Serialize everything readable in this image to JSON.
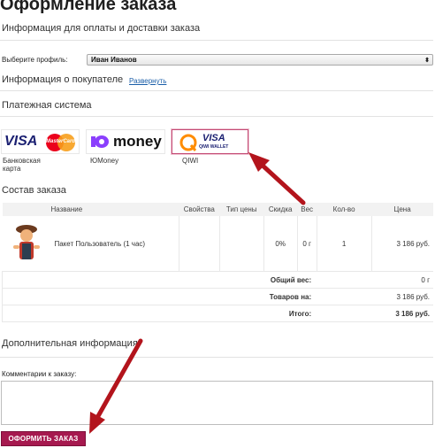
{
  "page": {
    "title": "Оформление заказа",
    "payment_delivery_info": "Информация для оплаты и доставки заказа"
  },
  "profile": {
    "label": "Выберите профиль:",
    "selected": "Иван Иванов"
  },
  "buyer": {
    "title": "Информация о покупателе",
    "expand_link": "Развернуть"
  },
  "payment": {
    "title": "Платежная система",
    "options": [
      {
        "label": "Банковская карта",
        "logo_text_1": "VISA",
        "logo_text_2": "MasterCard",
        "selected": false
      },
      {
        "label": "ЮMoney",
        "logo_text_1": "money",
        "selected": false
      },
      {
        "label": "QIWI",
        "logo_text_1": "VISA",
        "logo_text_2": "QIWI WALLET",
        "selected": true
      }
    ]
  },
  "order": {
    "title": "Состав заказа",
    "columns": [
      "Название",
      "Свойства",
      "Тип цены",
      "Скидка",
      "Вес",
      "Кол-во",
      "Цена"
    ],
    "items": [
      {
        "name": "Пакет Пользователь (1 час)",
        "properties": "",
        "price_type": "",
        "discount": "0%",
        "weight": "0 г",
        "quantity": "1",
        "price": "3 186 руб."
      }
    ],
    "summary": [
      {
        "label": "Общий вес:",
        "value": "0 г"
      },
      {
        "label": "Товаров на:",
        "value": "3 186 руб."
      },
      {
        "label": "Итого:",
        "value": "3 186 руб."
      }
    ]
  },
  "extra": {
    "title": "Дополнительная информация",
    "comment_label": "Комментарии к заказу:",
    "comment_value": ""
  },
  "submit_label": "ОФОРМИТЬ ЗАКАЗ",
  "colors": {
    "accent": "#a6194f",
    "arrow": "#b3141c",
    "link": "#1a5ea8",
    "visa_blue": "#1a1f71",
    "mastercard_red": "#eb001b",
    "mastercard_orange": "#f79e1b",
    "yoomoney_purple": "#8b3ffd",
    "qiwi_orange": "#ff8c00"
  }
}
